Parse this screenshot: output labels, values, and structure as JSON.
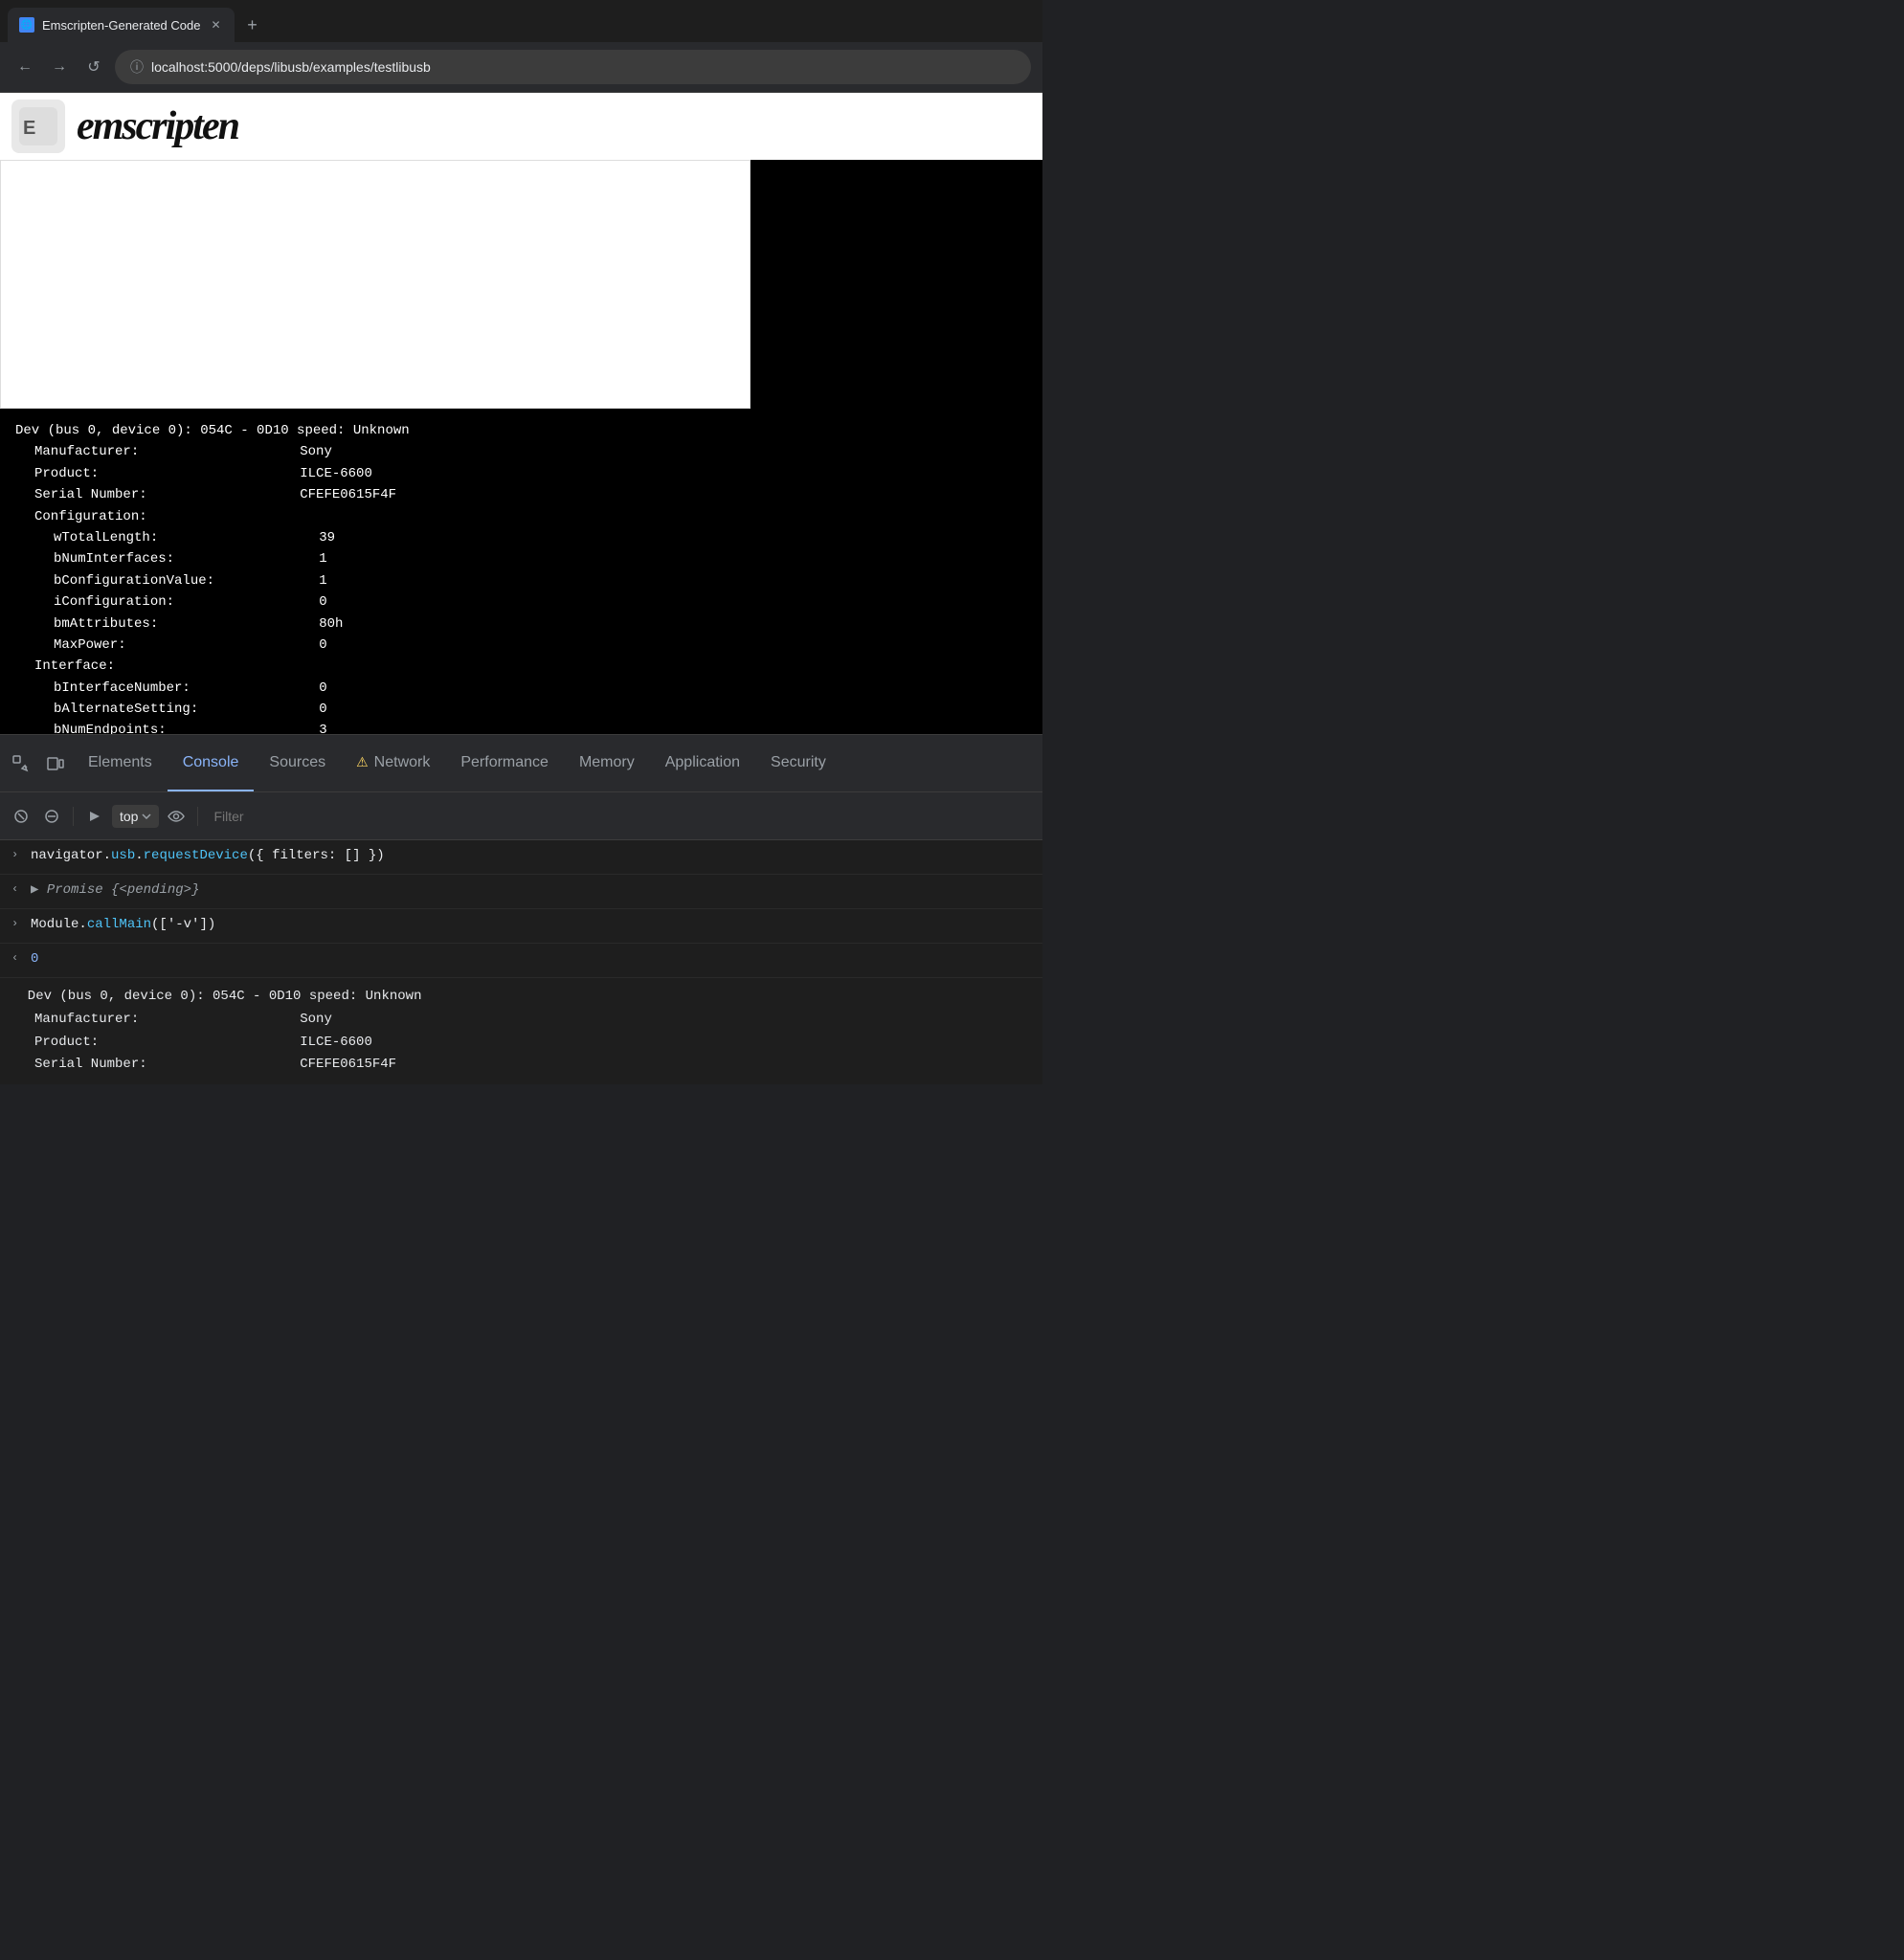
{
  "browser": {
    "tab": {
      "title": "Emscripten-Generated Code",
      "favicon": "🌐"
    },
    "url": "localhost:5000/deps/libusb/examples/testlibusb",
    "nav": {
      "back": "←",
      "forward": "→",
      "reload": "↺"
    }
  },
  "page": {
    "logo_text": "emscripten",
    "canvas_white": "",
    "canvas_black": ""
  },
  "terminal": {
    "lines": [
      {
        "text": "Dev (bus 0, device 0): 054C - 0D10 speed: Unknown",
        "indent": 0
      },
      {
        "text": "Manufacturer:                Sony",
        "indent": 1
      },
      {
        "text": "Product:                     ILCE-6600",
        "indent": 1
      },
      {
        "text": "Serial Number:               CFEFE0615F4F",
        "indent": 1
      },
      {
        "text": "Configuration:",
        "indent": 1
      },
      {
        "text": "wTotalLength:                39",
        "indent": 2
      },
      {
        "text": "bNumInterfaces:              1",
        "indent": 2
      },
      {
        "text": "bConfigurationValue:         1",
        "indent": 2
      },
      {
        "text": "iConfiguration:              0",
        "indent": 2
      },
      {
        "text": "bmAttributes:                80h",
        "indent": 2
      },
      {
        "text": "MaxPower:                    0",
        "indent": 2
      },
      {
        "text": "Interface:",
        "indent": 1
      },
      {
        "text": "bInterfaceNumber:            0",
        "indent": 2
      },
      {
        "text": "bAlternateSetting:           0",
        "indent": 2
      },
      {
        "text": "bNumEndpoints:               3",
        "indent": 2
      }
    ]
  },
  "devtools": {
    "tabs": [
      {
        "label": "Elements",
        "active": false,
        "id": "elements"
      },
      {
        "label": "Console",
        "active": true,
        "id": "console"
      },
      {
        "label": "Sources",
        "active": false,
        "id": "sources"
      },
      {
        "label": "Network",
        "active": false,
        "id": "network",
        "warning": true
      },
      {
        "label": "Performance",
        "active": false,
        "id": "performance"
      },
      {
        "label": "Memory",
        "active": false,
        "id": "memory"
      },
      {
        "label": "Application",
        "active": false,
        "id": "application"
      },
      {
        "label": "Security",
        "active": false,
        "id": "security"
      }
    ],
    "toolbar": {
      "top_label": "top",
      "filter_placeholder": "Filter"
    },
    "console_lines": [
      {
        "direction": "in",
        "parts": [
          {
            "text": "navigator.",
            "color": "white"
          },
          {
            "text": "usb",
            "color": "cyan"
          },
          {
            "text": ".",
            "color": "white"
          },
          {
            "text": "requestDevice",
            "color": "cyan"
          },
          {
            "text": "({ filters: [] })",
            "color": "white"
          }
        ]
      },
      {
        "direction": "out",
        "parts": [
          {
            "text": "▶ ",
            "color": "gray"
          },
          {
            "text": "Promise {<pending>}",
            "color": "gray",
            "italic": true
          }
        ]
      },
      {
        "direction": "in",
        "parts": [
          {
            "text": "Module",
            "color": "white"
          },
          {
            "text": ".",
            "color": "white"
          },
          {
            "text": "callMain",
            "color": "cyan"
          },
          {
            "text": "([",
            "color": "white"
          },
          {
            "text": "'-v'",
            "color": "white"
          },
          {
            "text": "])",
            "color": "white"
          }
        ]
      },
      {
        "direction": "out",
        "parts": [
          {
            "text": "0",
            "color": "blue"
          }
        ]
      }
    ],
    "sub_terminal": {
      "lines": [
        {
          "text": "Dev (bus 0, device 0): 054C - 0D10 speed: Unknown",
          "indent": 0
        },
        {
          "text": "Manufacturer:                Sony",
          "indent": 1
        },
        {
          "text": "Product:                     ILCE-6600",
          "indent": 1
        },
        {
          "text": "Serial Number:               CFEFE0615F4F",
          "indent": 1
        }
      ]
    }
  }
}
